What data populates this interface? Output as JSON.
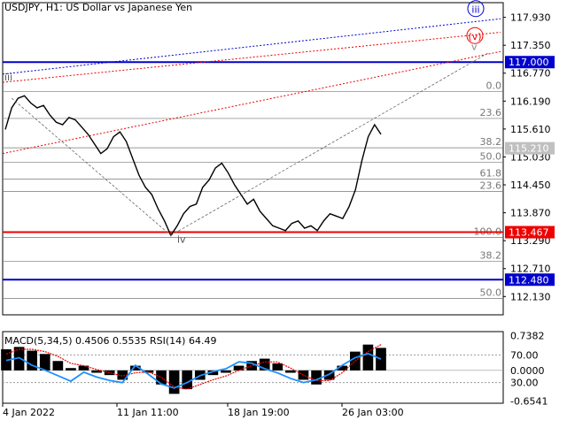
{
  "header": {
    "symbol_info": "USDJPY, H1:  US Dollar vs Japanese Yen",
    "indicator_info": "MACD(5,34,5) 0.4506 0.5535 RSI(14) 64.49"
  },
  "chart_data": [
    {
      "type": "line",
      "title": "USDJPY, H1:  US Dollar vs Japanese Yen",
      "ylim": [
        111.75,
        118.18
      ],
      "x_ticks": [
        "4 Jan 2022",
        "11 Jan 11:00",
        "18 Jan 19:00",
        "26 Jan 03:00"
      ],
      "y_ticks": [
        "117.930",
        "117.350",
        "116.770",
        "116.190",
        "115.610",
        "115.030",
        "114.450",
        "113.870",
        "113.290",
        "112.710",
        "112.130"
      ],
      "series": [
        {
          "values": [
            115.6,
            116.05,
            116.25,
            116.3,
            116.15,
            116.05,
            116.1,
            115.9,
            115.75,
            115.7,
            115.85,
            115.8,
            115.65,
            115.5,
            115.3,
            115.1,
            115.2,
            115.45,
            115.55,
            115.35,
            115.0,
            114.65,
            114.4,
            114.25,
            113.95,
            113.7,
            113.4,
            113.6,
            113.85,
            114.0,
            114.05,
            114.4,
            114.55,
            114.8,
            114.9,
            114.7,
            114.45,
            114.25,
            114.05,
            114.15,
            113.9,
            113.75,
            113.6,
            113.55,
            113.5,
            113.65,
            113.7,
            113.55,
            113.6,
            113.5,
            113.7,
            113.85,
            113.8,
            113.75,
            114.0,
            114.35,
            114.95,
            115.45,
            115.7,
            115.5
          ]
        }
      ],
      "levels": [
        {
          "value": 117.0,
          "label": "117.000",
          "color": "#0000cc",
          "boxed": true
        },
        {
          "value": 113.467,
          "label": "113.467",
          "color": "#ee0000",
          "boxed": true
        },
        {
          "value": 112.48,
          "label": "112.480",
          "color": "#0000cc",
          "boxed": true
        },
        {
          "value": 115.21,
          "label": "115.210",
          "color": "#c0c0c0",
          "boxed": true
        }
      ],
      "fib_levels": [
        {
          "value": 116.39,
          "label": "0.0"
        },
        {
          "value": 115.83,
          "label": "23.6"
        },
        {
          "value": 115.22,
          "label": "38.2"
        },
        {
          "value": 114.92,
          "label": "50.0"
        },
        {
          "value": 114.57,
          "label": "61.8"
        },
        {
          "value": 114.31,
          "label": "23.6"
        },
        {
          "value": 113.36,
          "label": "100.0"
        },
        {
          "value": 112.86,
          "label": "38.2"
        },
        {
          "value": 112.09,
          "label": "50.0"
        }
      ],
      "wave_labels": [
        {
          "text": "iii",
          "color": "#555555"
        },
        {
          "text": "iv",
          "color": "#555555"
        },
        {
          "text": "v",
          "color": "#888888"
        },
        {
          "text": "(v)",
          "color": "#ee0000"
        },
        {
          "text": "iii",
          "color": "#0000cc"
        }
      ],
      "colors": {
        "price": "#000000",
        "guide_blue": "#0000cc",
        "guide_red": "#ee0000",
        "guide_grey": "#666666"
      }
    },
    {
      "type": "bar",
      "title": "MACD(5,34,5) 0.4506 0.5535 RSI(14) 64.49",
      "ylim": [
        -0.7,
        0.77
      ],
      "y_ticks": [
        "0.7382",
        "70.00",
        "0.0000",
        "30.00",
        "-0.6541"
      ],
      "series": [
        {
          "name": "MACD",
          "values": [
            0.45,
            0.5,
            0.42,
            0.35,
            0.2,
            0.05,
            0.1,
            -0.05,
            -0.1,
            -0.2,
            0.1,
            -0.05,
            -0.3,
            -0.5,
            -0.4,
            -0.2,
            -0.1,
            -0.05,
            0.1,
            0.2,
            0.25,
            0.15,
            -0.05,
            -0.2,
            -0.3,
            -0.2,
            0.1,
            0.4,
            0.55,
            0.48
          ]
        },
        {
          "name": "Signal",
          "values": [
            0.35,
            0.45,
            0.45,
            0.4,
            0.3,
            0.15,
            0.1,
            0.02,
            -0.05,
            -0.12,
            -0.05,
            -0.03,
            -0.15,
            -0.35,
            -0.4,
            -0.3,
            -0.2,
            -0.12,
            0.0,
            0.1,
            0.18,
            0.18,
            0.05,
            -0.1,
            -0.22,
            -0.22,
            -0.05,
            0.2,
            0.4,
            0.55
          ]
        },
        {
          "name": "RSI",
          "values": [
            62,
            66,
            55,
            48,
            40,
            32,
            45,
            38,
            33,
            30,
            55,
            42,
            28,
            22,
            30,
            40,
            46,
            50,
            60,
            58,
            50,
            44,
            36,
            30,
            34,
            42,
            55,
            66,
            72,
            64
          ]
        }
      ],
      "colors": {
        "histogram": "#000000",
        "signal": "#ee0000",
        "rsi": "#1e90ff"
      }
    }
  ]
}
